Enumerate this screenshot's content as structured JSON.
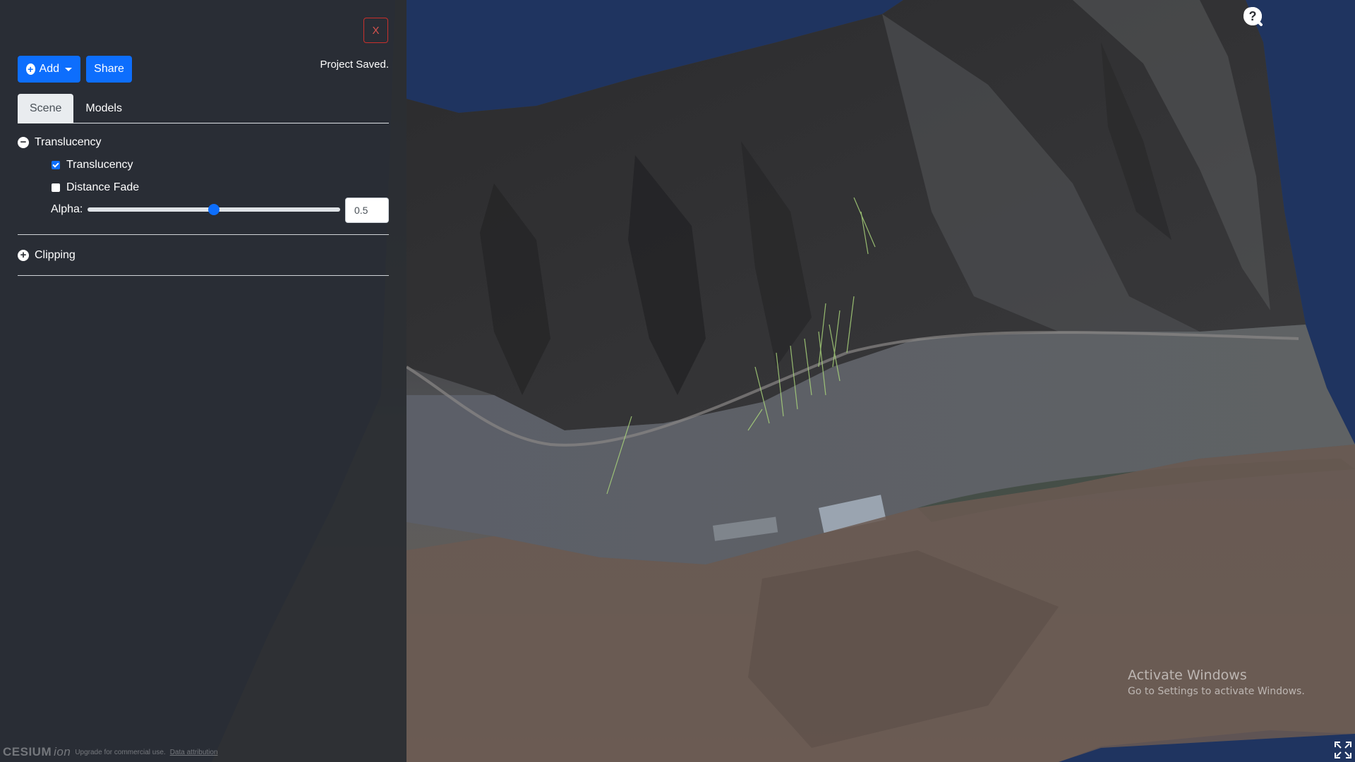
{
  "panel": {
    "close_label": "X",
    "add_label": "Add",
    "share_label": "Share",
    "status": "Project Saved.",
    "tabs": [
      {
        "label": "Scene",
        "active": true
      },
      {
        "label": "Models",
        "active": false
      }
    ],
    "sections": {
      "translucency": {
        "title": "Translucency",
        "expanded": true,
        "options": [
          {
            "label": "Translucency",
            "checked": true
          },
          {
            "label": "Distance Fade",
            "checked": false
          }
        ],
        "alpha_label": "Alpha:",
        "alpha_value": "0.5",
        "alpha_fraction": 0.5
      },
      "clipping": {
        "title": "Clipping",
        "expanded": false
      }
    }
  },
  "toolbar": {
    "icons": [
      "search-icon",
      "home-icon",
      "globe-icon",
      "help-icon"
    ]
  },
  "watermark": {
    "title": "Activate Windows",
    "subtitle": "Go to Settings to activate Windows."
  },
  "credits": {
    "logo_main": "CESIUM",
    "logo_sub": "ion",
    "upgrade": "Upgrade for commercial use.",
    "attribution": "Data attribution"
  },
  "colors": {
    "primary": "#0d6efd",
    "danger": "#d9534f",
    "panel_bg": "#2a2d32",
    "sky": "#1f3460"
  }
}
